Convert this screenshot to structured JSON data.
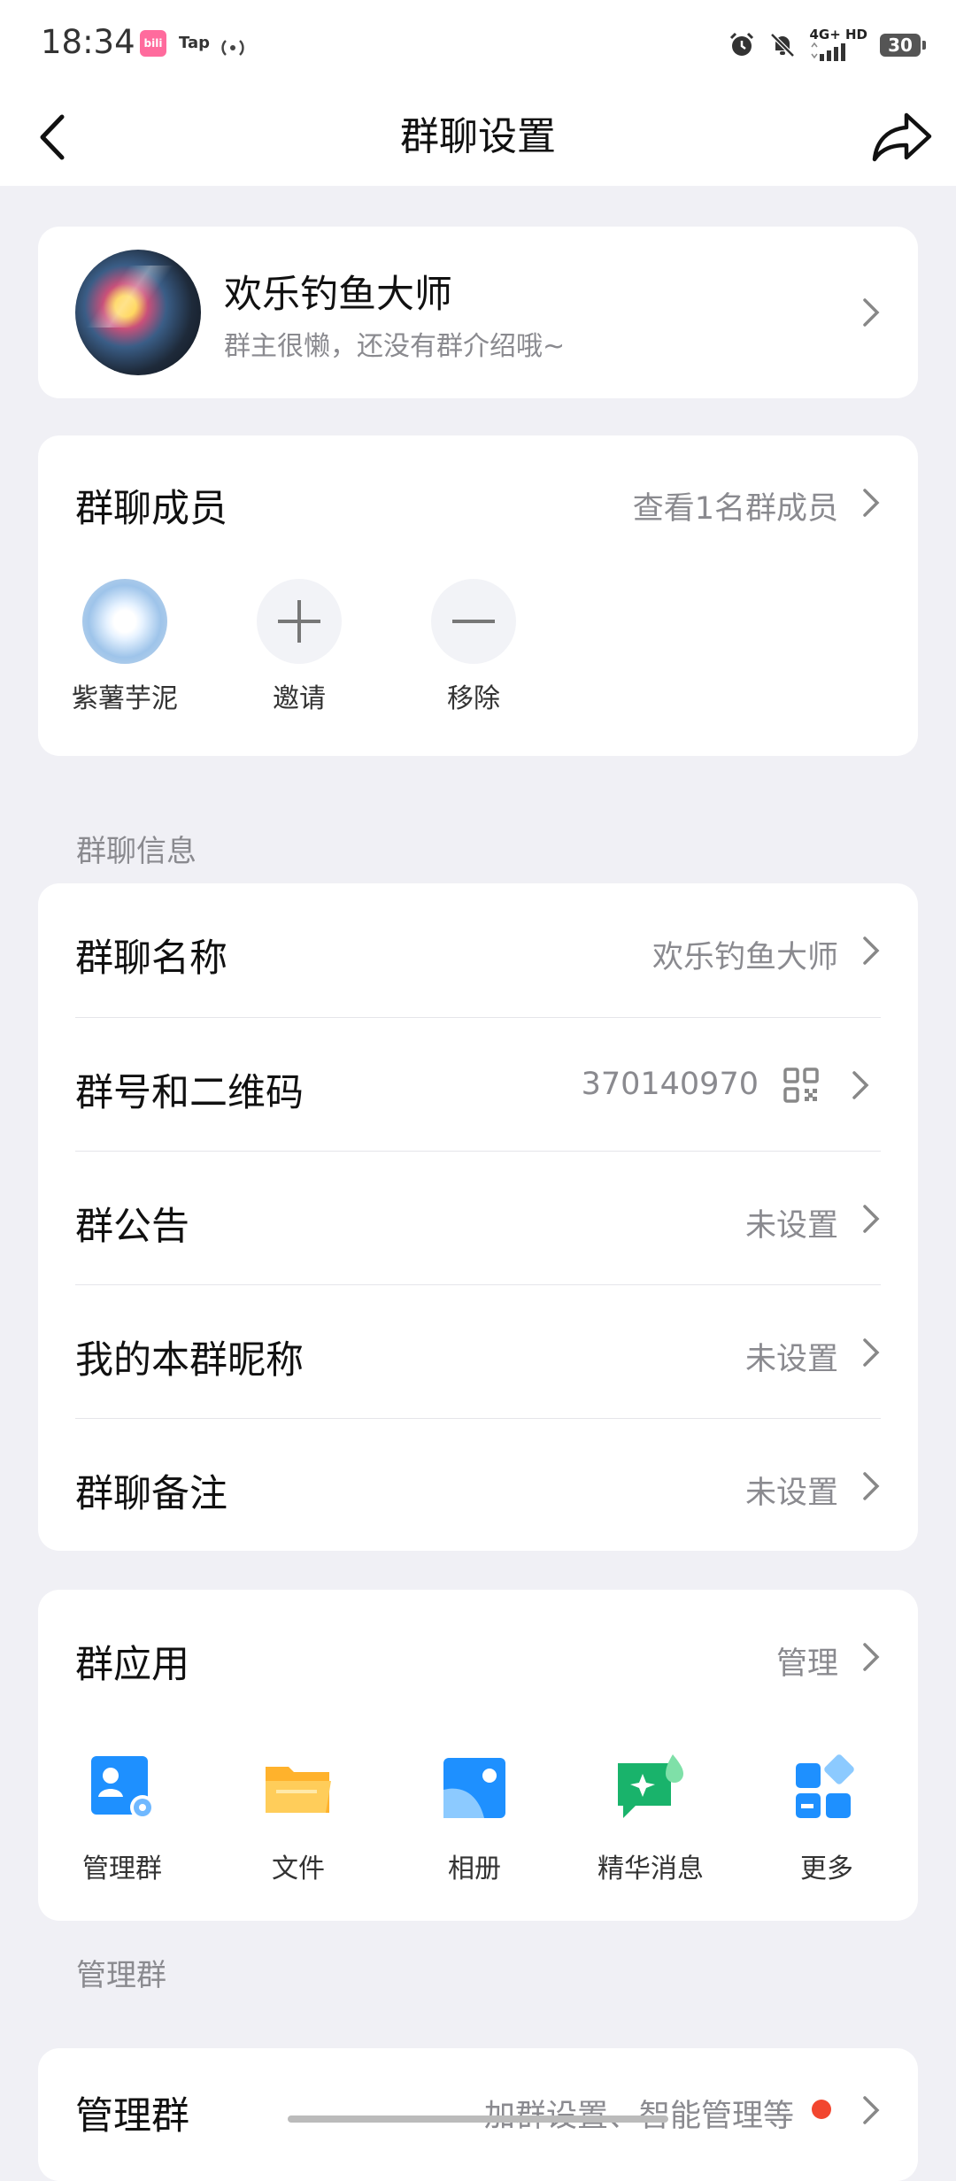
{
  "status_bar": {
    "time": "18:34",
    "app1": "bili",
    "app2": "Tap",
    "signal_text": "4G+ HD",
    "battery": "30"
  },
  "nav": {
    "title": "群聊设置"
  },
  "group_card": {
    "name": "欢乐钓鱼大师",
    "description": "群主很懒，还没有群介绍哦~"
  },
  "members": {
    "title": "群聊成员",
    "view_all": "查看1名群成员",
    "items": [
      {
        "label": "紫薯芋泥"
      },
      {
        "label": "邀请"
      },
      {
        "label": "移除"
      }
    ]
  },
  "info_section": {
    "header": "群聊信息",
    "rows": [
      {
        "label": "群聊名称",
        "value": "欢乐钓鱼大师"
      },
      {
        "label": "群号和二维码",
        "value": "370140970"
      },
      {
        "label": "群公告",
        "value": "未设置"
      },
      {
        "label": "我的本群昵称",
        "value": "未设置"
      },
      {
        "label": "群聊备注",
        "value": "未设置"
      }
    ]
  },
  "apps": {
    "title": "群应用",
    "manage": "管理",
    "items": [
      {
        "label": "管理群",
        "icon": "manage-group-icon"
      },
      {
        "label": "文件",
        "icon": "folder-icon"
      },
      {
        "label": "相册",
        "icon": "album-icon"
      },
      {
        "label": "精华消息",
        "icon": "essence-message-icon"
      },
      {
        "label": "更多",
        "icon": "more-apps-icon"
      }
    ]
  },
  "admin_section": {
    "header": "管理群",
    "row_label": "管理群",
    "row_value": "加群设置、智能管理等"
  },
  "colors": {
    "accent_blue": "#1e90ff",
    "folder_yellow": "#ffc043",
    "green": "#19b36b",
    "badge_red": "#f2462f"
  }
}
